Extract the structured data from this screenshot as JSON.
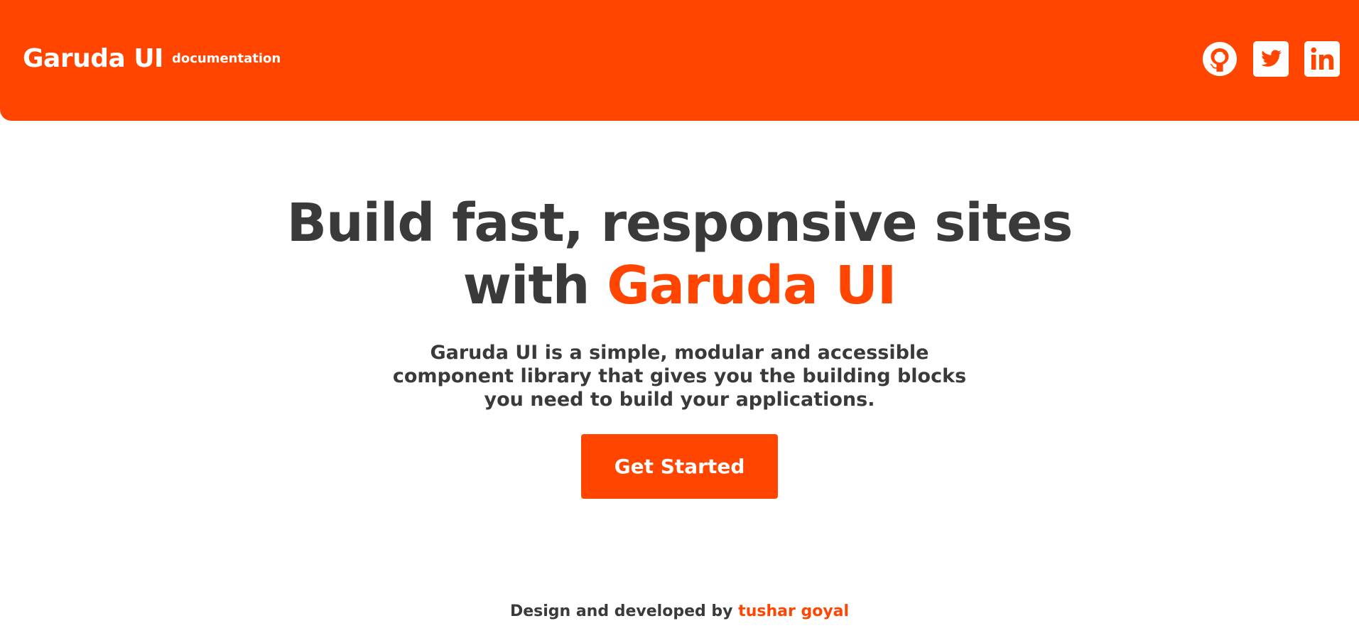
{
  "colors": {
    "brand": "#ff4500",
    "text": "#3a3a3a",
    "background": "#ffffff"
  },
  "header": {
    "brand_name": "Garuda UI",
    "brand_sub": "documentation",
    "social": [
      {
        "icon": "github-icon"
      },
      {
        "icon": "twitter-icon"
      },
      {
        "icon": "linkedin-icon"
      }
    ]
  },
  "hero": {
    "headline_line1": "Build fast, responsive sites",
    "headline_with": "with",
    "headline_accent": "Garuda UI",
    "description": "Garuda UI is a simple, modular and accessible component library that gives you the building blocks you need to build your applications.",
    "cta_label": "Get Started"
  },
  "footer": {
    "text": "Design and developed by",
    "author": "tushar goyal"
  }
}
